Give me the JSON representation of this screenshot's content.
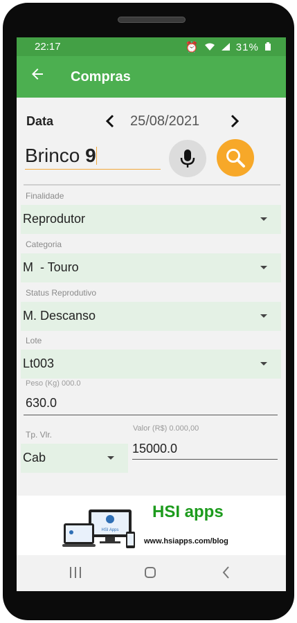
{
  "status_bar": {
    "time": "22:17",
    "battery": "31%"
  },
  "app_bar": {
    "title": "Compras"
  },
  "date_row": {
    "label": "Data",
    "value": "25/08/2021"
  },
  "search": {
    "value_prefix": "Brinco ",
    "value_suffix": "9"
  },
  "fields": {
    "finalidade": {
      "label": "Finalidade",
      "value": "Reprodutor"
    },
    "categoria": {
      "label": "Categoria",
      "value": "M  - Touro"
    },
    "status": {
      "label": "Status Reprodutivo",
      "value": "M. Descanso"
    },
    "lote": {
      "label": "Lote",
      "value": "Lt003"
    },
    "peso": {
      "hint": "Peso (Kg) 000.0",
      "value": "630.0"
    },
    "tp_vlr": {
      "label": "Tp. Vlr.",
      "value": "Cab"
    },
    "valor": {
      "hint": "Valor (R$) 0.000,00",
      "value": "15000.0"
    }
  },
  "banner": {
    "title": "HSI apps",
    "url": "www.hsiapps.com/blog",
    "screen_text": "HSI Apps"
  },
  "colors": {
    "primary": "#4caf50",
    "status_bar": "#43a045",
    "accent": "#f7a829",
    "field_bg": "#e4f1e5"
  }
}
